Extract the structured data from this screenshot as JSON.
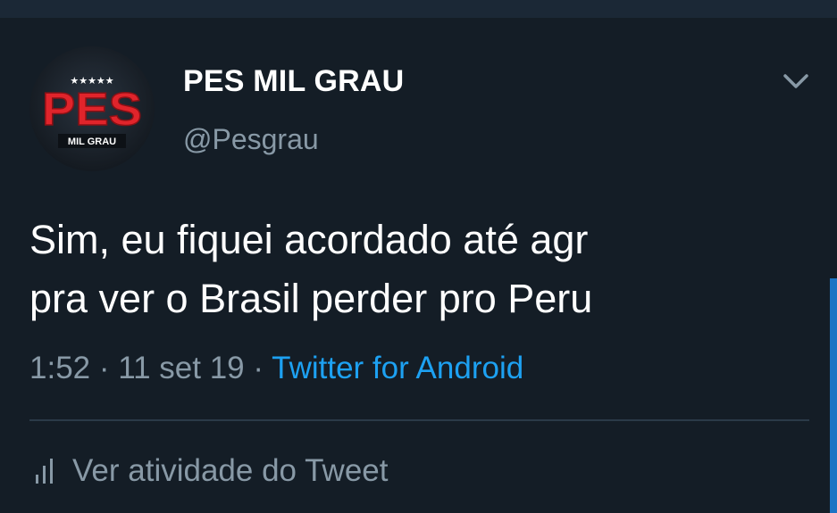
{
  "tweet": {
    "display_name": "PES MIL GRAU",
    "handle": "@Pesgrau",
    "text_lines": [
      "Sim, eu fiquei acordado até agr",
      "pra ver o Brasil perder pro Peru"
    ],
    "time": "1:52",
    "separator": " · ",
    "date": "11 set 19",
    "source": "Twitter for Android",
    "activity_label": "Ver atividade do Tweet"
  },
  "avatar": {
    "logo_text": "PES",
    "logo_subtext": "MIL GRAU",
    "logo_stars": "★★★★★"
  },
  "icons": {
    "menu": "chevron-down-icon",
    "activity": "bar-chart-icon"
  },
  "colors": {
    "background": "#141d26",
    "secondary_text": "#8899a6",
    "link": "#1da1f2",
    "logo_red": "#e0242b"
  }
}
